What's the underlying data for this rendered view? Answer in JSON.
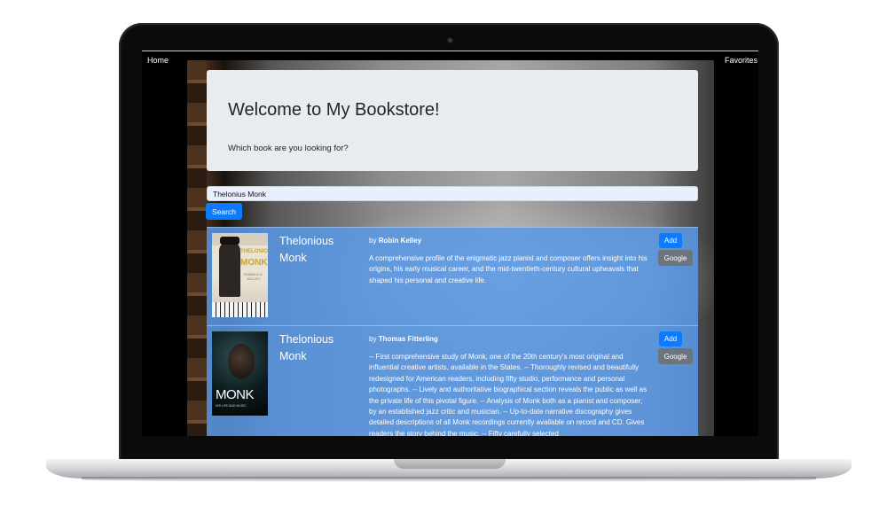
{
  "nav": {
    "home_label": "Home",
    "favorites_label": "Favorites"
  },
  "jumbotron": {
    "title": "Welcome to My Bookstore!",
    "subtitle": "Which book are you looking for?"
  },
  "search": {
    "value": "Thelonius Monk",
    "button_label": "Search"
  },
  "results": [
    {
      "title": "Thelonious Monk",
      "by": "by",
      "author": "Robin Kelley",
      "description": "A comprehensive profile of the enigmatic jazz pianist and composer offers insight into his origins, his early musical career, and the mid-twentieth-century cultural upheavals that shaped his personal and creative life.",
      "add_label": "Add",
      "google_label": "Google",
      "cover_text": [
        "THELONIOUS",
        "MONK",
        "ROBIN D.G. KELLEY"
      ]
    },
    {
      "title": "Thelonious Monk",
      "by": "by",
      "author": "Thomas Fitterling",
      "description": "-- First comprehensive study of Monk, one of the 20th century's most original and influential creative artists, available in the States. -- Thoroughly revised and beautifully redesigned for American readers, including fifty studio, performance and personal photographs. -- Lively and authoritative biographical section reveals the public as well as the private life of this pivotal figure. -- Analysis of Monk both as a pianist and composer, by an established jazz critic and musician. -- Up-to-date narrative discography gives detailed descriptions of all Monk recordings currently available on record and CD. Gives readers the story behind the music. -- Fifty carefully selected",
      "add_label": "Add",
      "google_label": "Google",
      "cover_text": [
        "MONK",
        "HIS LIFE AND MUSIC"
      ]
    }
  ]
}
